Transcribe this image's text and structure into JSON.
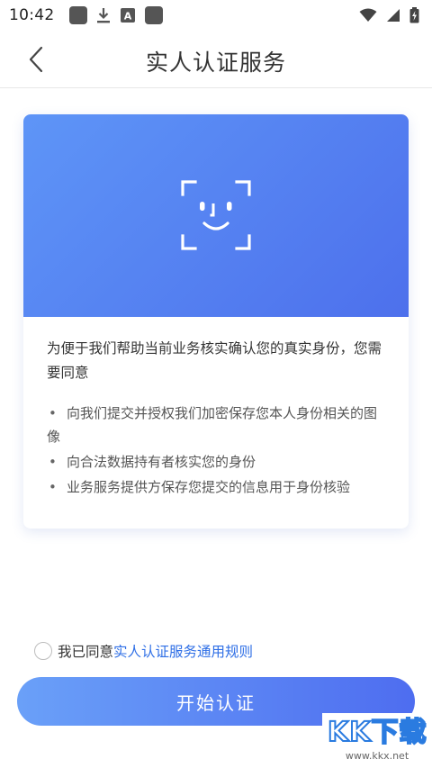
{
  "status_bar": {
    "time": "10:42",
    "icons": [
      "app-square-icon",
      "download-icon",
      "a-notification-icon",
      "app-square-icon",
      "wifi-icon",
      "signal-icon",
      "battery-charging-icon"
    ]
  },
  "header": {
    "title": "实人认证服务",
    "back_icon": "chevron-left-icon"
  },
  "card": {
    "banner_colors": [
      "#5e95f7",
      "#4d70ec"
    ],
    "banner_icon": "face-scan-icon",
    "intro": "为便于我们帮助当前业务核实确认您的真实身份，您需要同意",
    "bullets": [
      "向我们提交并授权我们加密保存您本人身份相关的图像",
      "向合法数据持有者核实您的身份",
      "业务服务提供方保存您提交的信息用于身份核验"
    ]
  },
  "agreement": {
    "checked": false,
    "text": "我已同意",
    "link": "实人认证服务通用规则",
    "link_color": "#2f6fe6"
  },
  "start_button": {
    "label": "开始认证",
    "colors": [
      "#6aa0f8",
      "#4e6df0"
    ]
  },
  "watermark": {
    "main": "KK下载",
    "sub": "www.kkx.net"
  }
}
